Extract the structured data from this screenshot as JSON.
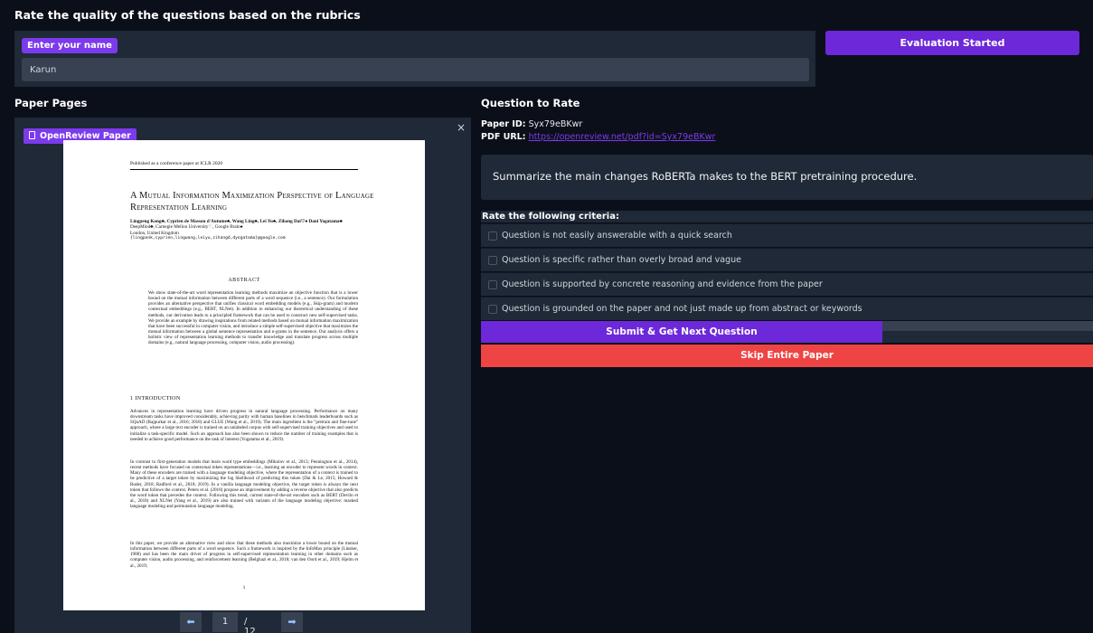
{
  "header": {
    "title": "Rate the quality of the questions based on the rubrics"
  },
  "name_field": {
    "label": "Enter your name",
    "value": "Karun"
  },
  "evaluation_button": {
    "label": "Evaluation Started"
  },
  "paper_pages": {
    "heading": "Paper Pages",
    "close_glyph": "×",
    "badge_label": "OpenReview Paper",
    "current_page": "1",
    "total_pages": "/ 12",
    "prev_glyph": "⬅",
    "next_glyph": "➡"
  },
  "paper": {
    "header_line": "Published as a conference paper at ICLR 2020",
    "title": "A Mutual Information Maximization Perspective of Language Representation Learning",
    "authors": "Lingpeng Kong♣, Cyprien de Masson d'Autume♣, Wang Ling♣, Lei Yu♣, Zihang Dai♡♠ Dani Yogatama♣",
    "affiliation": "DeepMind♣, Carnegie Mellon University♡, Google Brain♠",
    "location": "London, United Kingdom",
    "emails": "{lingpenk,cyprien,lingwang,leiyu,zihangd,dyogatama}@google.com",
    "abstract_heading": "ABSTRACT",
    "abstract": "We show state-of-the-art word representation learning methods maximize an objective function that is a lower bound on the mutual information between different parts of a word sequence (i.e., a sentence). Our formulation provides an alternative perspective that unifies classical word embedding models (e.g., Skip-gram) and modern contextual embeddings (e.g., BERT, XLNet). In addition to enhancing our theoretical understanding of these methods, our derivation leads to a principled framework that can be used to construct new self-supervised tasks. We provide an example by drawing inspirations from related methods based on mutual information maximization that have been successful in computer vision, and introduce a simple self-supervised objective that maximizes the mutual information between a global sentence representation and n-grams in the sentence. Our analysis offers a holistic view of representation learning methods to transfer knowledge and translate progress across multiple domains (e.g., natural language processing, computer vision, audio processing).",
    "intro_heading": "1   INTRODUCTION",
    "para1": "Advances in representation learning have driven progress in natural language processing. Performance on many downstream tasks have improved considerably, achieving parity with human baselines in benchmark leaderboards such as SQuAD (Rajpurkar et al., 2016; 2018) and GLUE (Wang et al., 2019). The main ingredient is the \"pretrain and fine-tune\" approach, where a large text encoder is trained on an unlabeled corpus with self-supervised training objectives and used to initialize a task-specific model. Such an approach has also been shown to reduce the number of training examples that is needed to achieve good performance on the task of interest (Yogatama et al., 2019).",
    "para2": "In contrast to first-generation models that learn word type embeddings (Mikolov et al., 2013; Pennington et al., 2014), recent methods have focused on contextual token representations—i.e., learning an encoder to represent words in context. Many of these encoders are trained with a language modeling objective, where the representation of a context is trained to be predictive of a target token by maximizing the log likelihood of predicting this token (Dai & Le, 2015; Howard & Ruder, 2018; Radford et al., 2018; 2019). In a vanilla language modeling objective, the target token is always the next token that follows the context. Peters et al. (2018) propose an improvement by adding a reverse objective that also predicts the word token that precedes the context. Following this trend, current state-of-the-art encoders such as BERT (Devlin et al., 2018) and XLNet (Yang et al., 2019) are also trained with variants of the language modeling objective: masked language modeling and permutation language modeling.",
    "para3": "In this paper, we provide an alternative view and show that these methods also maximize a lower bound on the mutual information between different parts of a word sequence. Such a framework is inspired by the InfoMax principle (Linsker, 1988) and has been the main driver of progress in self-supervised representation learning in other domains such as computer vision, audio processing, and reinforcement learning (Belghazi et al., 2018; van den Oord et al., 2019; Hjelm et al., 2019;",
    "page_number": "1"
  },
  "question_panel": {
    "heading": "Question to Rate",
    "paper_id_label": "Paper ID:",
    "paper_id_value": "Syx79eBKwr",
    "pdf_url_label": "PDF URL:",
    "pdf_url_value": "https://openreview.net/pdf?id=Syx79eBKwr",
    "question": "Summarize the main changes RoBERTa makes to the BERT pretraining procedure."
  },
  "criteria": {
    "heading": "Rate the following criteria:",
    "items": [
      {
        "label": "Question is not easily answerable with a quick search"
      },
      {
        "label": "Question is specific rather than overly broad and vague"
      },
      {
        "label": "Question is supported by concrete reasoning and evidence from the paper"
      },
      {
        "label": "Question is grounded on the paper and not just made up from abstract or keywords"
      }
    ]
  },
  "actions": {
    "submit_label": "Submit & Get Next Question",
    "skip_label": "Skip Entire Paper"
  },
  "colors": {
    "accent": "#6d28d9",
    "danger": "#ef4444",
    "background": "#0b0f19",
    "panel": "#1f2937"
  }
}
